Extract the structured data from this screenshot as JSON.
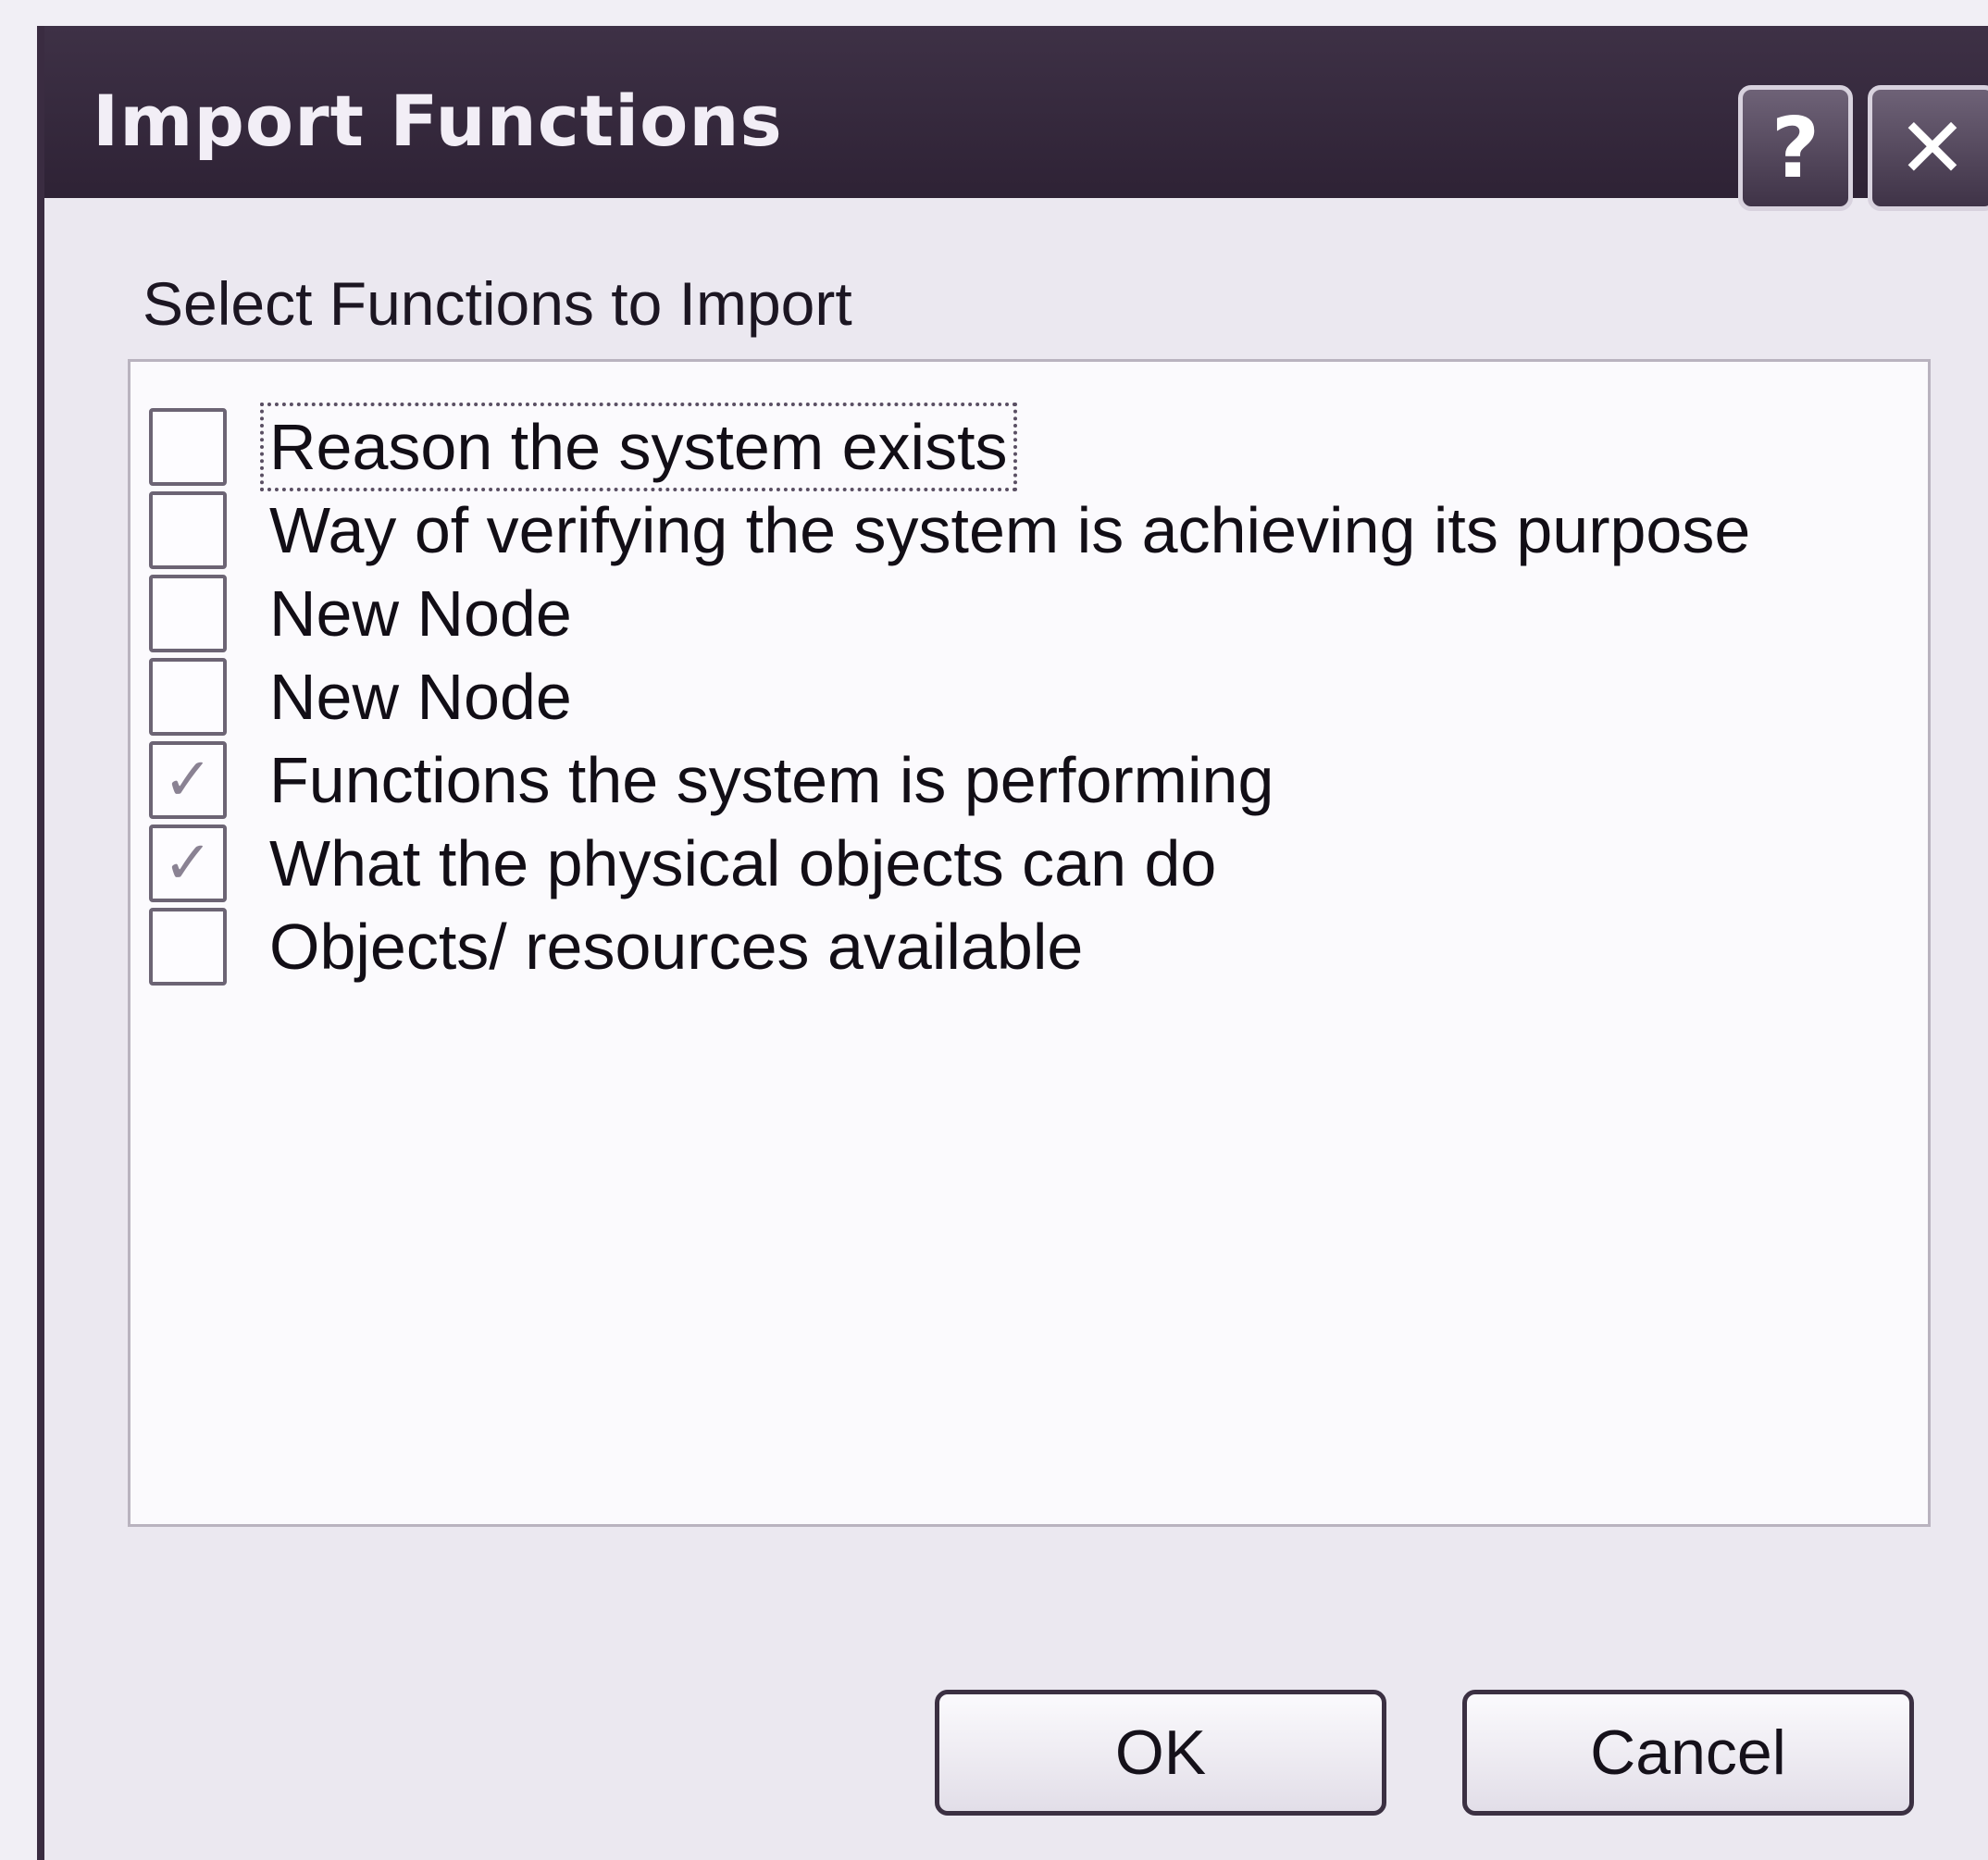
{
  "window": {
    "title": "Import Functions",
    "help_label": "?",
    "close_label": "✕"
  },
  "prompt": "Select Functions to Import",
  "items": [
    {
      "label": "Reason the system exists",
      "checked": false,
      "focused": true
    },
    {
      "label": "Way of verifying the system is achieving its purpose",
      "checked": false,
      "focused": false
    },
    {
      "label": "New Node",
      "checked": false,
      "focused": false
    },
    {
      "label": "New Node",
      "checked": false,
      "focused": false
    },
    {
      "label": "Functions the system is performing",
      "checked": true,
      "focused": false
    },
    {
      "label": "What the physical objects can do",
      "checked": true,
      "focused": false
    },
    {
      "label": "Objects/ resources available",
      "checked": false,
      "focused": false
    }
  ],
  "buttons": {
    "ok": "OK",
    "cancel": "Cancel"
  },
  "colors": {
    "titlebar": "#2e2235",
    "dialog_bg": "#ebe8f0",
    "list_bg": "#fbfafd"
  }
}
